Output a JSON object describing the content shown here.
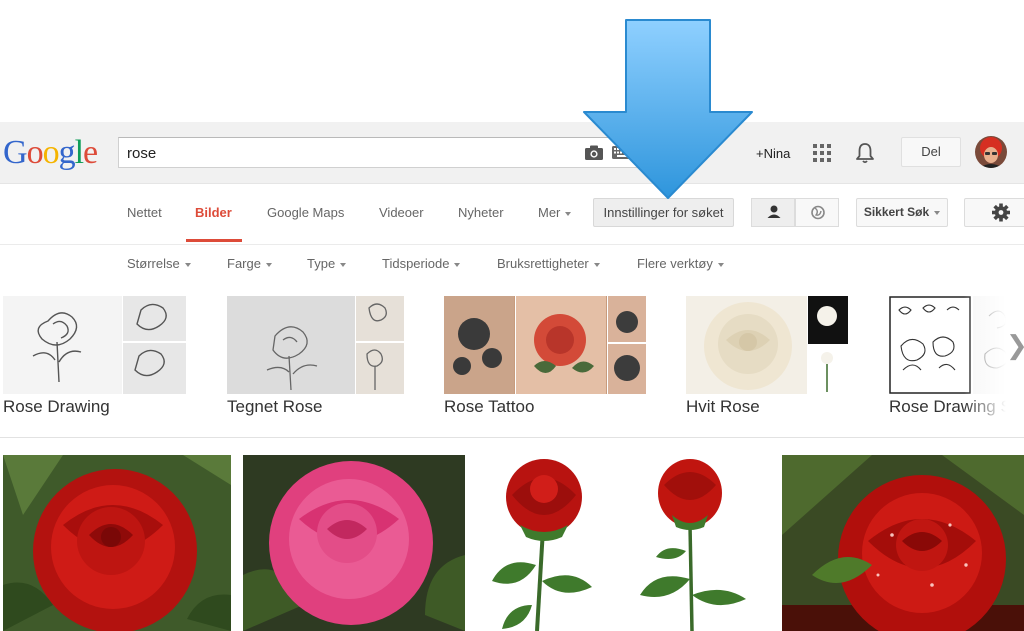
{
  "logo": {
    "text": "Google",
    "letters": [
      "G",
      "o",
      "o",
      "g",
      "l",
      "e"
    ],
    "colors": [
      "#3366cc",
      "#dd4b39",
      "#f5b400",
      "#3366cc",
      "#109d59",
      "#dd4b39"
    ]
  },
  "search": {
    "value": "rose",
    "icons": [
      "camera-icon",
      "keyboard-icon"
    ]
  },
  "account": {
    "plus_name": "+Nina",
    "share_label": "Del",
    "icons": [
      "apps-grid-icon",
      "notifications-bell-icon",
      "avatar"
    ]
  },
  "tabs": [
    {
      "label": "Nettet",
      "active": false
    },
    {
      "label": "Bilder",
      "active": true
    },
    {
      "label": "Google Maps",
      "active": false
    },
    {
      "label": "Videoer",
      "active": false
    },
    {
      "label": "Nyheter",
      "active": false
    },
    {
      "label": "Mer",
      "active": false,
      "dropdown": true
    }
  ],
  "search_tools_label": "Innstillinger for søket",
  "view_toggle": {
    "icons": [
      "person-icon",
      "globe-icon"
    ],
    "selected": "person-icon"
  },
  "safe_search_label": "Sikkert Søk",
  "settings_icon": "gear-icon",
  "filters": [
    "Størrelse",
    "Farge",
    "Type",
    "Tidsperiode",
    "Bruksrettigheter",
    "Flere verktøy"
  ],
  "related": [
    {
      "label": "Rose Drawing"
    },
    {
      "label": "Tegnet Rose"
    },
    {
      "label": "Rose Tattoo"
    },
    {
      "label": "Hvit Rose"
    },
    {
      "label": "Rose Drawing S"
    }
  ],
  "results_count_visible": 5,
  "colors": {
    "accent": "#dd4b39",
    "arrow": "#56b1ed",
    "header_bg": "#f1f1f1"
  }
}
